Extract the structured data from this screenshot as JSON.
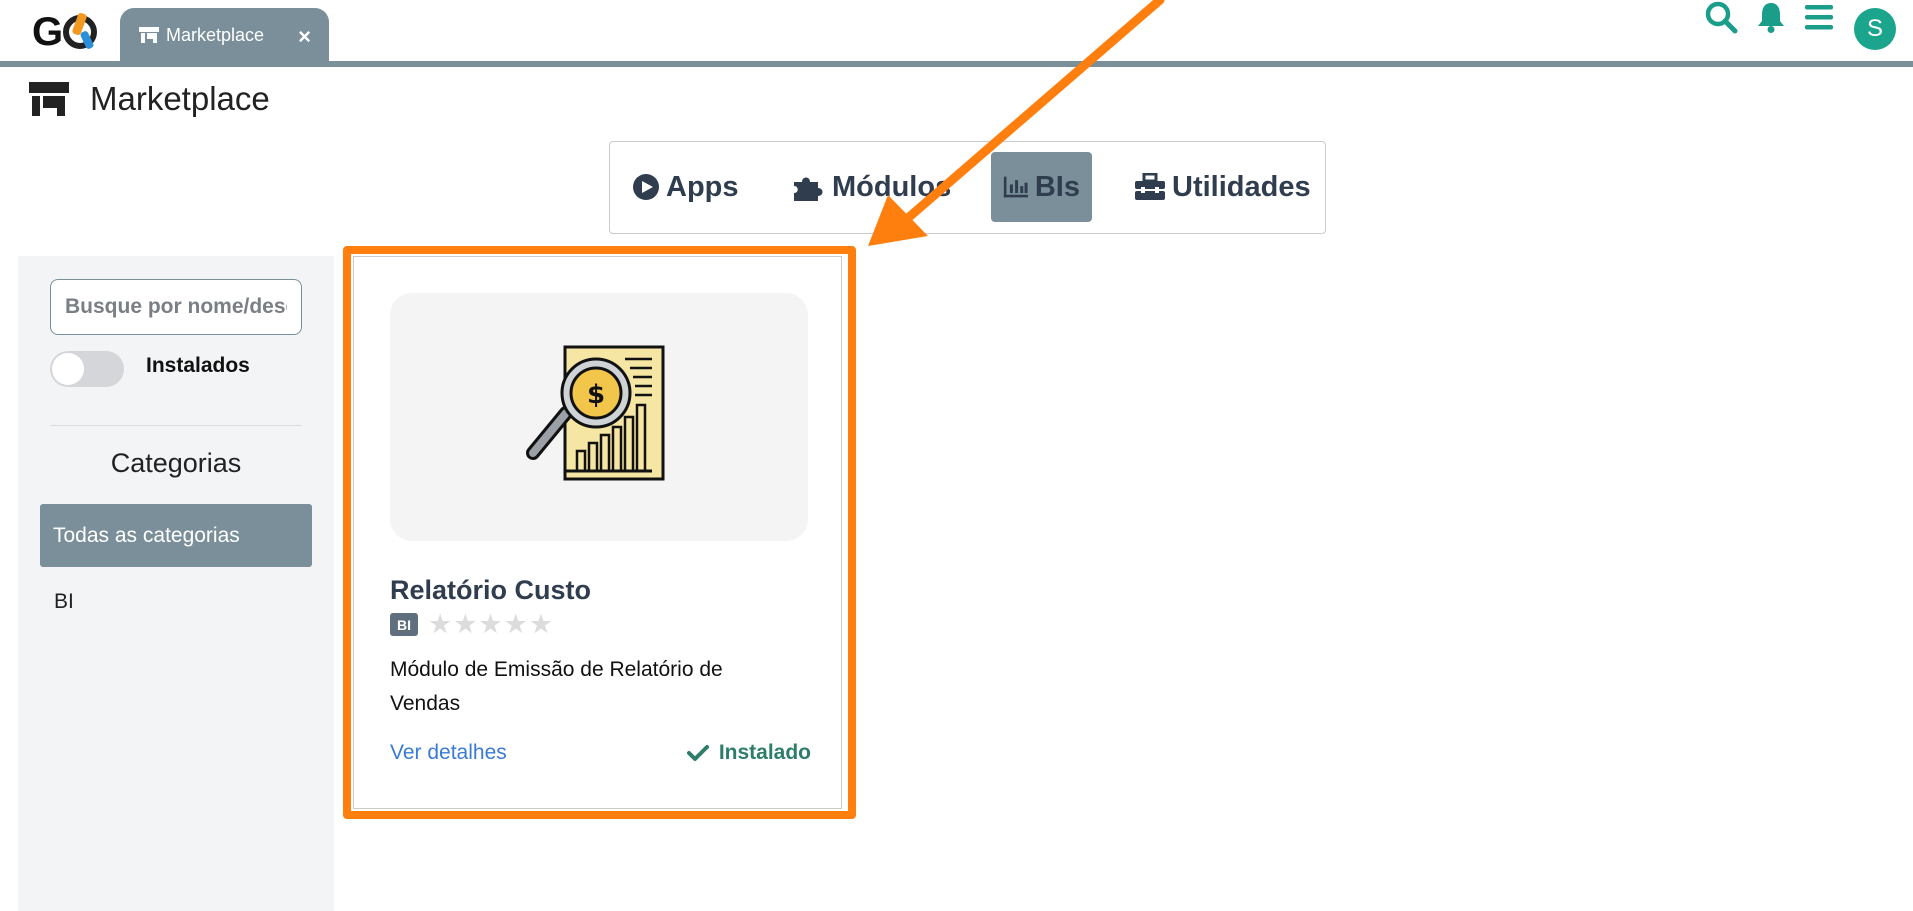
{
  "header": {
    "logo": "GO",
    "tab_label": "Marketplace",
    "tab_close": "×",
    "avatar_initial": "S",
    "icons": [
      "search-icon",
      "bell-icon",
      "menu-icon"
    ]
  },
  "page": {
    "title": "Marketplace",
    "icon": "store-icon"
  },
  "category_tabs": [
    {
      "label": "Apps",
      "icon": "play-circle-icon",
      "active": false
    },
    {
      "label": "Módulos",
      "icon": "puzzle-icon",
      "active": false
    },
    {
      "label": "BIs",
      "icon": "chart-bar-icon",
      "active": true
    },
    {
      "label": "Utilidades",
      "icon": "toolbox-icon",
      "active": false
    }
  ],
  "sidebar": {
    "search_placeholder": "Busque por nome/descrição",
    "toggle_label": "Instalados",
    "toggle_on": false,
    "categories_title": "Categorias",
    "items": [
      {
        "label": "Todas as categorias",
        "active": true
      },
      {
        "label": "BI",
        "active": false
      }
    ]
  },
  "card": {
    "title": "Relatório Custo",
    "badge": "BI",
    "stars": "★★★★★",
    "rating": 0,
    "description": "Módulo de Emissão de Relatório de Vendas",
    "details_link": "Ver detalhes",
    "status": "Instalado"
  },
  "colors": {
    "accent": "#7a8f99",
    "highlight": "#ff7f0e",
    "installed": "#2e7d6a",
    "link": "#3a7bd5",
    "avatar": "#1aa58c",
    "icon_teal": "#1a9e8a"
  }
}
